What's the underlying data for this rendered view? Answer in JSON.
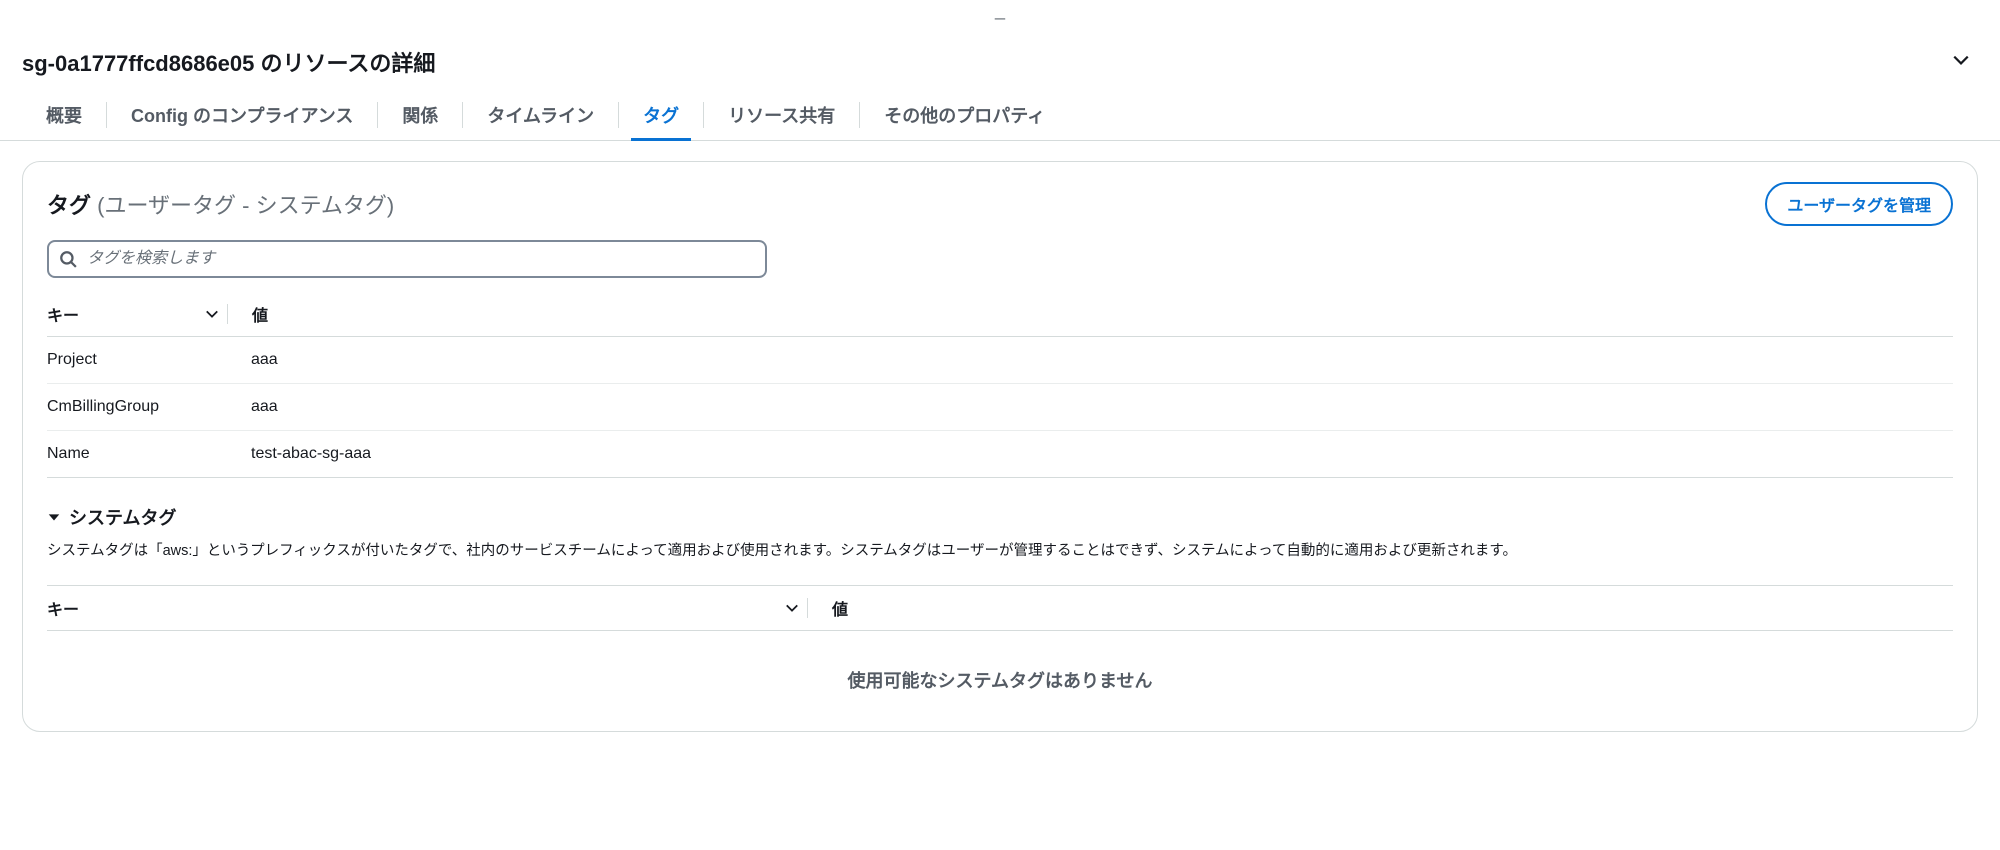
{
  "header": {
    "minimize": "_",
    "title": "sg-0a1777ffcd8686e05 のリソースの詳細"
  },
  "tabs": [
    {
      "label": "概要",
      "active": false
    },
    {
      "label": "Config のコンプライアンス",
      "active": false
    },
    {
      "label": "関係",
      "active": false
    },
    {
      "label": "タイムライン",
      "active": false
    },
    {
      "label": "タグ",
      "active": true
    },
    {
      "label": "リソース共有",
      "active": false
    },
    {
      "label": "その他のプロパティ",
      "active": false
    }
  ],
  "panel": {
    "title": "タグ",
    "subtitle": "(ユーザータグ - システムタグ)",
    "manage_button": "ユーザータグを管理",
    "search_placeholder": "タグを検索します",
    "columns": {
      "key": "キー",
      "value": "値"
    }
  },
  "user_tags": [
    {
      "key": "Project",
      "value": "aaa"
    },
    {
      "key": "CmBillingGroup",
      "value": "aaa"
    },
    {
      "key": "Name",
      "value": "test-abac-sg-aaa"
    }
  ],
  "system_tags": {
    "title": "システムタグ",
    "description": "システムタグは「aws:」というプレフィックスが付いたタグで、社内のサービスチームによって適用および使用されます。システムタグはユーザーが管理することはできず、システムによって自動的に適用および更新されます。",
    "columns": {
      "key": "キー",
      "value": "値"
    },
    "empty": "使用可能なシステムタグはありません"
  }
}
